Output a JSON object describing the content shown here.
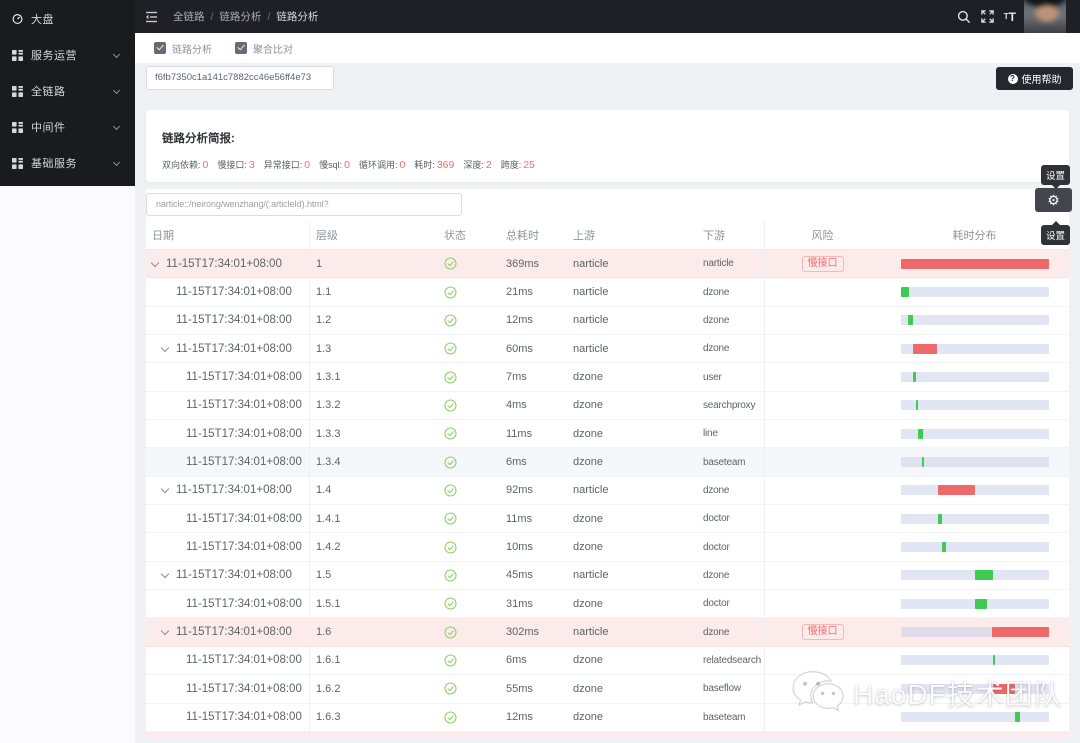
{
  "topbar": {
    "breadcrumb": [
      "全链路",
      "链路分析",
      "链路分析"
    ]
  },
  "sidebar": {
    "items": [
      {
        "label": "大盘",
        "icon": "dashboard-icon",
        "chevron": false
      },
      {
        "label": "服务运营",
        "icon": "apps-icon",
        "chevron": true
      },
      {
        "label": "全链路",
        "icon": "apps-icon",
        "chevron": true
      },
      {
        "label": "中间件",
        "icon": "apps-icon",
        "chevron": true
      },
      {
        "label": "基础服务",
        "icon": "apps-icon",
        "chevron": true
      }
    ]
  },
  "toolbar": {
    "checkboxes": [
      {
        "label": "链路分析",
        "checked": true
      },
      {
        "label": "聚合比对",
        "checked": true
      }
    ]
  },
  "trace_id_input": {
    "value": "f6fb7350c1a141c7882cc46e56ff4e73"
  },
  "help_button": {
    "label": "使用帮助"
  },
  "summary": {
    "title": "链路分析简报:",
    "stats": [
      {
        "label": "双向依赖:",
        "value": "0"
      },
      {
        "label": "慢接口:",
        "value": "3"
      },
      {
        "label": "异常接口:",
        "value": "0"
      },
      {
        "label": "慢sql:",
        "value": "0"
      },
      {
        "label": "循环调用:",
        "value": "0"
      },
      {
        "label": "耗时:",
        "value": "369"
      },
      {
        "label": "深度:",
        "value": "2"
      },
      {
        "label": "跨度:",
        "value": "25"
      }
    ]
  },
  "settings": {
    "tooltip_top": "设置",
    "tooltip_bottom": "设置"
  },
  "filter_input": {
    "value": "narticle::/neirong/wenzhang/(:articleId).html?"
  },
  "table": {
    "columns": [
      "日期",
      "层级",
      "状态",
      "总耗时",
      "上游",
      "下游",
      "风险",
      "耗时分布"
    ],
    "rows": [
      {
        "date": "11-15T17:34:01+08:00",
        "level": "1",
        "indent": 0,
        "expandable": true,
        "status": "success",
        "duration": "369ms",
        "upstream": "narticle",
        "downstream": "narticle",
        "risk": "慢接口",
        "highlight": true,
        "hover": false,
        "bar": {
          "start_pct": 0,
          "width_pct": 100,
          "color": "red"
        }
      },
      {
        "date": "11-15T17:34:01+08:00",
        "level": "1.1",
        "indent": 1,
        "expandable": false,
        "status": "success",
        "duration": "21ms",
        "upstream": "narticle",
        "downstream": "dzone",
        "risk": "",
        "highlight": false,
        "hover": false,
        "bar": {
          "start_pct": 0,
          "width_pct": 5.7,
          "color": "green"
        }
      },
      {
        "date": "11-15T17:34:01+08:00",
        "level": "1.2",
        "indent": 1,
        "expandable": false,
        "status": "success",
        "duration": "12ms",
        "upstream": "narticle",
        "downstream": "dzone",
        "risk": "",
        "highlight": false,
        "hover": false,
        "bar": {
          "start_pct": 4.8,
          "width_pct": 3.3,
          "color": "green"
        }
      },
      {
        "date": "11-15T17:34:01+08:00",
        "level": "1.3",
        "indent": 1,
        "expandable": true,
        "status": "success",
        "duration": "60ms",
        "upstream": "narticle",
        "downstream": "dzone",
        "risk": "",
        "highlight": false,
        "hover": false,
        "bar": {
          "start_pct": 8.1,
          "width_pct": 16.3,
          "color": "red"
        }
      },
      {
        "date": "11-15T17:34:01+08:00",
        "level": "1.3.1",
        "indent": 2,
        "expandable": false,
        "status": "success",
        "duration": "7ms",
        "upstream": "dzone",
        "downstream": "user",
        "risk": "",
        "highlight": false,
        "hover": false,
        "bar": {
          "start_pct": 8.4,
          "width_pct": 1.9,
          "color": "green"
        }
      },
      {
        "date": "11-15T17:34:01+08:00",
        "level": "1.3.2",
        "indent": 2,
        "expandable": false,
        "status": "success",
        "duration": "4ms",
        "upstream": "dzone",
        "downstream": "searchproxy",
        "risk": "",
        "highlight": false,
        "hover": false,
        "bar": {
          "start_pct": 10.3,
          "width_pct": 1.2,
          "color": "green"
        }
      },
      {
        "date": "11-15T17:34:01+08:00",
        "level": "1.3.3",
        "indent": 2,
        "expandable": false,
        "status": "success",
        "duration": "11ms",
        "upstream": "dzone",
        "downstream": "line",
        "risk": "",
        "highlight": false,
        "hover": false,
        "bar": {
          "start_pct": 11.6,
          "width_pct": 3.0,
          "color": "green"
        }
      },
      {
        "date": "11-15T17:34:01+08:00",
        "level": "1.3.4",
        "indent": 2,
        "expandable": false,
        "status": "success",
        "duration": "6ms",
        "upstream": "dzone",
        "downstream": "baseteam",
        "risk": "",
        "highlight": false,
        "hover": true,
        "bar": {
          "start_pct": 14.0,
          "width_pct": 1.7,
          "color": "green"
        }
      },
      {
        "date": "11-15T17:34:01+08:00",
        "level": "1.4",
        "indent": 1,
        "expandable": true,
        "status": "success",
        "duration": "92ms",
        "upstream": "narticle",
        "downstream": "dzone",
        "risk": "",
        "highlight": false,
        "hover": false,
        "bar": {
          "start_pct": 25.0,
          "width_pct": 24.9,
          "color": "red"
        }
      },
      {
        "date": "11-15T17:34:01+08:00",
        "level": "1.4.1",
        "indent": 2,
        "expandable": false,
        "status": "success",
        "duration": "11ms",
        "upstream": "dzone",
        "downstream": "doctor",
        "risk": "",
        "highlight": false,
        "hover": false,
        "bar": {
          "start_pct": 25.0,
          "width_pct": 3.0,
          "color": "green"
        }
      },
      {
        "date": "11-15T17:34:01+08:00",
        "level": "1.4.2",
        "indent": 2,
        "expandable": false,
        "status": "success",
        "duration": "10ms",
        "upstream": "dzone",
        "downstream": "doctor",
        "risk": "",
        "highlight": false,
        "hover": false,
        "bar": {
          "start_pct": 27.8,
          "width_pct": 2.7,
          "color": "green"
        }
      },
      {
        "date": "11-15T17:34:01+08:00",
        "level": "1.5",
        "indent": 1,
        "expandable": true,
        "status": "success",
        "duration": "45ms",
        "upstream": "narticle",
        "downstream": "dzone",
        "risk": "",
        "highlight": false,
        "hover": false,
        "bar": {
          "start_pct": 50.0,
          "width_pct": 12.2,
          "color": "green"
        }
      },
      {
        "date": "11-15T17:34:01+08:00",
        "level": "1.5.1",
        "indent": 2,
        "expandable": false,
        "status": "success",
        "duration": "31ms",
        "upstream": "dzone",
        "downstream": "doctor",
        "risk": "",
        "highlight": false,
        "hover": false,
        "bar": {
          "start_pct": 50.0,
          "width_pct": 8.4,
          "color": "green"
        }
      },
      {
        "date": "11-15T17:34:01+08:00",
        "level": "1.6",
        "indent": 1,
        "expandable": true,
        "status": "success",
        "duration": "302ms",
        "upstream": "narticle",
        "downstream": "dzone",
        "risk": "慢接口",
        "highlight": true,
        "hover": false,
        "bar": {
          "start_pct": 61.5,
          "width_pct": 38.5,
          "color": "red"
        }
      },
      {
        "date": "11-15T17:34:01+08:00",
        "level": "1.6.1",
        "indent": 2,
        "expandable": false,
        "status": "success",
        "duration": "6ms",
        "upstream": "dzone",
        "downstream": "relatedsearch",
        "risk": "",
        "highlight": false,
        "hover": false,
        "bar": {
          "start_pct": 62.0,
          "width_pct": 1.7,
          "color": "green"
        }
      },
      {
        "date": "11-15T17:34:01+08:00",
        "level": "1.6.2",
        "indent": 2,
        "expandable": false,
        "status": "success",
        "duration": "55ms",
        "upstream": "dzone",
        "downstream": "baseflow",
        "risk": "",
        "highlight": false,
        "hover": false,
        "bar": {
          "start_pct": 62.0,
          "width_pct": 14.9,
          "color": "red"
        }
      },
      {
        "date": "11-15T17:34:01+08:00",
        "level": "1.6.3",
        "indent": 2,
        "expandable": false,
        "status": "success",
        "duration": "12ms",
        "upstream": "dzone",
        "downstream": "baseteam",
        "risk": "",
        "highlight": false,
        "hover": false,
        "bar": {
          "start_pct": 77.0,
          "width_pct": 3.3,
          "color": "green"
        }
      }
    ],
    "next_row_clipped": true
  },
  "watermark": {
    "text": "HaoDF技术团队"
  },
  "colors": {
    "risk_red": "#f56c6c",
    "bar_red": "#ee6a6a",
    "bar_green": "#3dcb53",
    "row_highlight": "#fcebeb",
    "bar_track": "#e4e8f4"
  }
}
